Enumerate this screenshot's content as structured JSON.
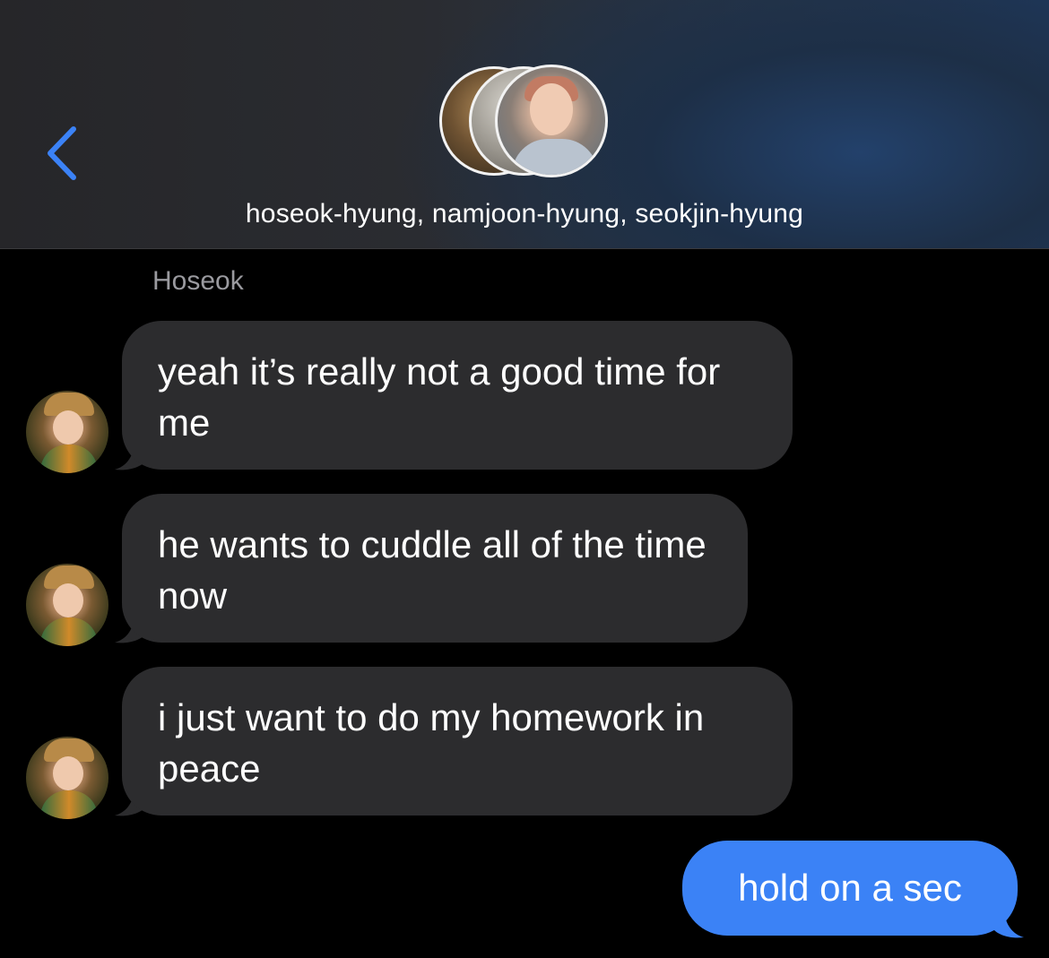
{
  "header": {
    "group_names": "hoseok-hyung, namjoon-hyung, seokjin-hyung"
  },
  "colors": {
    "back_icon": "#3b82f6",
    "incoming_bubble": "#2c2c2e",
    "outgoing_bubble": "#3b82f6",
    "sender_name": "#9a9a9f"
  },
  "conversation": {
    "sender_name": "Hoseok",
    "incoming": [
      {
        "text": "yeah it’s really not a good time for me"
      },
      {
        "text": "he wants to cuddle all of the time now"
      },
      {
        "text": "i just want to do my homework in peace"
      }
    ],
    "outgoing": [
      {
        "text": "hold on a sec"
      }
    ]
  }
}
